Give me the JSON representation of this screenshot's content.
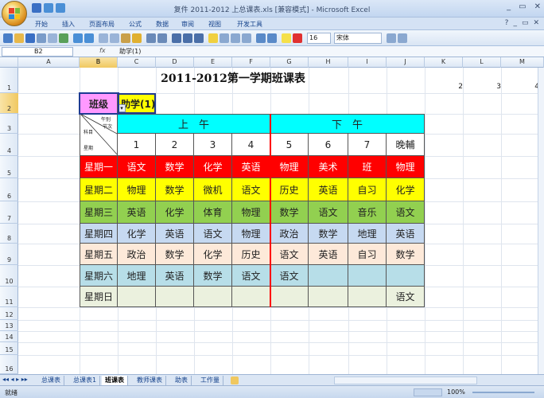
{
  "window": {
    "title": "复件 2011-2012 上总课表.xls [兼容模式] - Microsoft Excel",
    "controls": [
      "_",
      "▭",
      "✕"
    ]
  },
  "ribbon_tabs": [
    "开始",
    "插入",
    "页面布局",
    "公式",
    "数据",
    "审阅",
    "视图",
    "开发工具"
  ],
  "ribbon_right": [
    "?",
    "_",
    "▭",
    "✕"
  ],
  "toolbar": {
    "font_size": "16",
    "font_name": "宋体"
  },
  "formula_bar": {
    "name_box": "B2",
    "fx": "fx",
    "content": "助学(1)"
  },
  "columns": [
    "A",
    "B",
    "C",
    "D",
    "E",
    "F",
    "G",
    "H",
    "I",
    "J",
    "K",
    "L",
    "M"
  ],
  "rows": [
    "1",
    "2",
    "3",
    "4",
    "5",
    "6",
    "7",
    "8",
    "9",
    "10",
    "11",
    "12",
    "13",
    "14",
    "15",
    "16"
  ],
  "sheet": {
    "title": "2011-2012第一学期班课表",
    "k1": "2",
    "l1": "3",
    "m1": "4",
    "class_label": "班级",
    "class_value": "助学(1)",
    "diag": {
      "top": "午别",
      "sub": "节次",
      "mid": "科目",
      "bottom": "星期"
    },
    "am": "上　午",
    "pm": "下　午",
    "periods": [
      "1",
      "2",
      "3",
      "4",
      "5",
      "6",
      "7",
      "晚輔"
    ],
    "days": [
      {
        "day": "星期一",
        "cells": [
          "语文",
          "数学",
          "化学",
          "英语",
          "物理",
          "美术",
          "班",
          "物理"
        ],
        "color": "#ff0000",
        "text": "#ffffff"
      },
      {
        "day": "星期二",
        "cells": [
          "物理",
          "数学",
          "微机",
          "语文",
          "历史",
          "英语",
          "自习",
          "化学"
        ],
        "color": "#ffff00",
        "text": "#222222"
      },
      {
        "day": "星期三",
        "cells": [
          "英语",
          "化学",
          "体育",
          "物理",
          "数学",
          "语文",
          "音乐",
          "语文"
        ],
        "color": "#92d050",
        "text": "#222222"
      },
      {
        "day": "星期四",
        "cells": [
          "化学",
          "英语",
          "语文",
          "物理",
          "政治",
          "数学",
          "地理",
          "英语"
        ],
        "color": "#c6d9f1",
        "text": "#222222"
      },
      {
        "day": "星期五",
        "cells": [
          "政治",
          "数学",
          "化学",
          "历史",
          "语文",
          "英语",
          "自习",
          "数学"
        ],
        "color": "#fde9d9",
        "text": "#222222"
      },
      {
        "day": "星期六",
        "cells": [
          "地理",
          "英语",
          "数学",
          "语文",
          "语文",
          "",
          "",
          ""
        ],
        "color": "#b7dee8",
        "text": "#222222"
      },
      {
        "day": "星期日",
        "cells": [
          "",
          "",
          "",
          "",
          "",
          "",
          "",
          "语文"
        ],
        "color": "#ebf1de",
        "text": "#222222"
      }
    ]
  },
  "sheet_tabs": [
    "总课表",
    "总课表1",
    "班课表",
    "教师课表",
    "助表",
    "工作量"
  ],
  "active_sheet": "班课表",
  "status": {
    "left": "就绪",
    "zoom": "100%"
  },
  "colors": {
    "header_cyan": "#00ffff",
    "class_label_bg": "#ff99ff",
    "divider_red": "#ff0000",
    "ribbon_blue": "#15428b"
  }
}
